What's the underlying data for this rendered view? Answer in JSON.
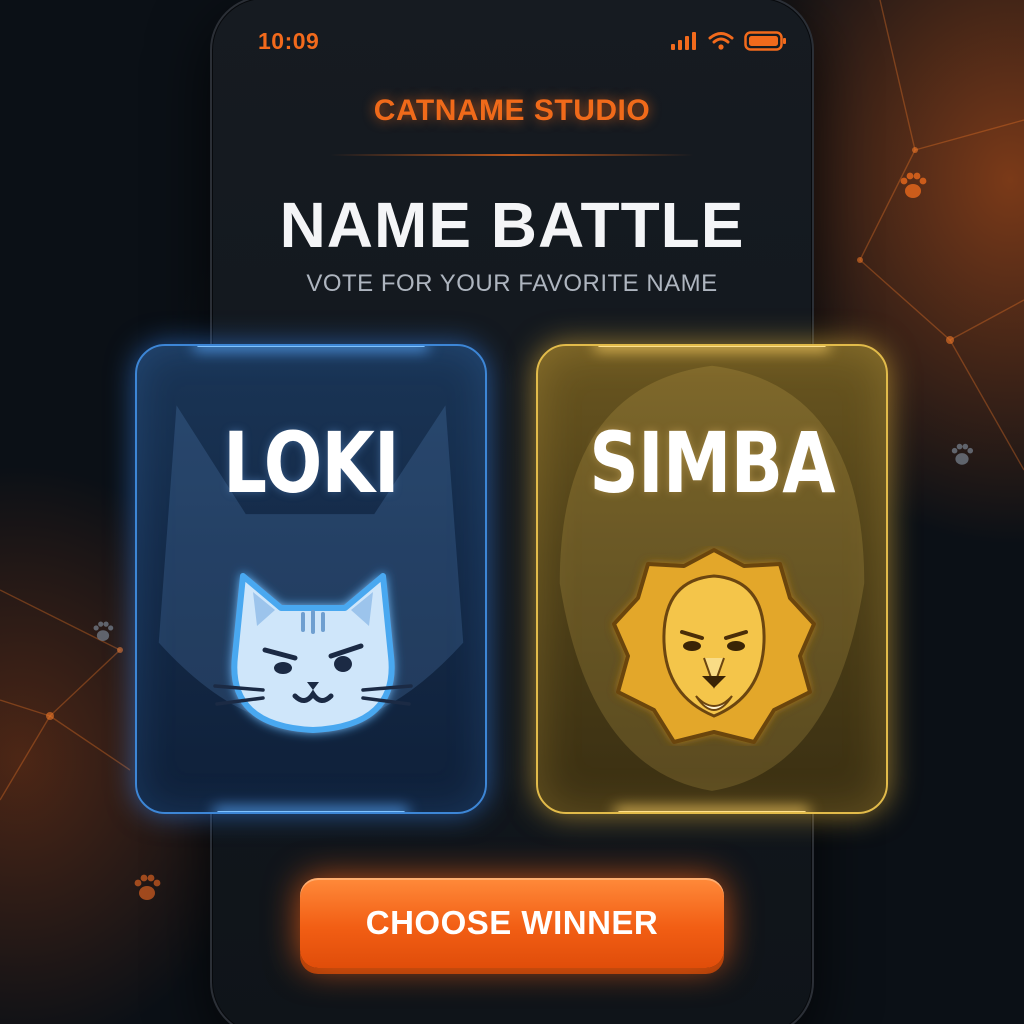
{
  "status_bar": {
    "time": "10:09"
  },
  "header": {
    "brand": "CATNAME STUDIO",
    "title": "NAME BATTLE",
    "subtitle": "VOTE FOR YOUR FAVORITE NAME"
  },
  "cards": [
    {
      "name": "LOKI",
      "mascot_icon": "cat-face-icon",
      "accent": "#3d86d6"
    },
    {
      "name": "SIMBA",
      "mascot_icon": "lion-face-icon",
      "accent": "#e2bb4a"
    }
  ],
  "actions": {
    "choose_winner": "CHOOSE WINNER"
  },
  "colors": {
    "brand_orange": "#f26a1c",
    "background": "#0d1218"
  }
}
